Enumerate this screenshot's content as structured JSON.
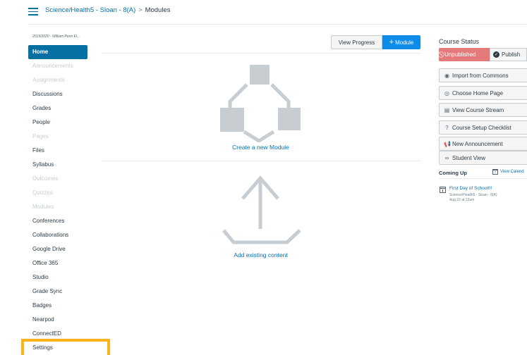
{
  "breadcrumb": {
    "course": "Science/Health5 - Sloan - 8(A)",
    "separator": ">",
    "current": "Modules"
  },
  "term_label": "2019/2020 - William Penn El...",
  "nav": [
    {
      "label": "Home",
      "state": "active"
    },
    {
      "label": "Announcements",
      "state": "hidden"
    },
    {
      "label": "Assignments",
      "state": "hidden"
    },
    {
      "label": "Discussions",
      "state": "normal"
    },
    {
      "label": "Grades",
      "state": "normal"
    },
    {
      "label": "People",
      "state": "normal"
    },
    {
      "label": "Pages",
      "state": "hidden"
    },
    {
      "label": "Files",
      "state": "normal"
    },
    {
      "label": "Syllabus",
      "state": "normal"
    },
    {
      "label": "Outcomes",
      "state": "hidden"
    },
    {
      "label": "Quizzes",
      "state": "hidden"
    },
    {
      "label": "Modules",
      "state": "hidden"
    },
    {
      "label": "Conferences",
      "state": "normal"
    },
    {
      "label": "Collaborations",
      "state": "normal"
    },
    {
      "label": "Google Drive",
      "state": "normal"
    },
    {
      "label": "Office 365",
      "state": "normal"
    },
    {
      "label": "Studio",
      "state": "normal"
    },
    {
      "label": "Grade Sync",
      "state": "normal"
    },
    {
      "label": "Badges",
      "state": "normal"
    },
    {
      "label": "Nearpod",
      "state": "normal"
    },
    {
      "label": "ConnectED",
      "state": "normal"
    },
    {
      "label": "Settings",
      "state": "normal"
    }
  ],
  "toolbar": {
    "view_progress": "View Progress",
    "add_module": "Module"
  },
  "main": {
    "create_module": "Create a new Module",
    "add_existing": "Add existing content"
  },
  "course_status": {
    "title": "Course Status",
    "unpublished": "Unpublished",
    "publish": "Publish"
  },
  "sidebar_buttons": [
    {
      "label": "Import from Commons",
      "icon": "commons-icon"
    },
    {
      "label": "Choose Home Page",
      "icon": "target-icon"
    },
    {
      "label": "View Course Stream",
      "icon": "stream-icon"
    },
    {
      "label": "Course Setup Checklist",
      "icon": "question-icon"
    },
    {
      "label": "New Announcement",
      "icon": "megaphone-icon"
    },
    {
      "label": "Student View",
      "icon": "glasses-icon"
    }
  ],
  "coming_up": {
    "title": "Coming Up",
    "view_calendar": "View Calend",
    "event": {
      "title": "First Day of School!!!",
      "course": "Science/Health5 - Sloan - 8(A)",
      "time": "Aug 22 at 12am"
    }
  },
  "colors": {
    "link": "#0770a3",
    "active_nav": "#0770a3",
    "add_button": "#0b8ce9",
    "unpublished": "#e57a7a",
    "highlight": "#ffb31a",
    "graphic": "#c7cdd1"
  }
}
